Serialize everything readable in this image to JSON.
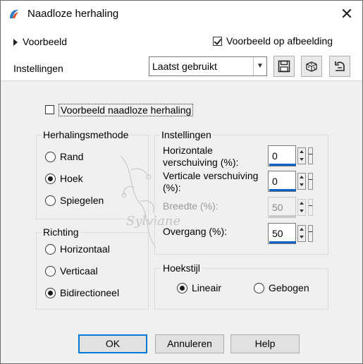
{
  "window": {
    "title": "Naadloze herhaling",
    "close_glyph": "✕"
  },
  "preview": {
    "toggle_label": "Voorbeeld",
    "on_image_label": "Voorbeeld op afbeelding",
    "on_image_checked": true
  },
  "settings_row": {
    "label": "Instellingen",
    "selected": "Laatst gebruikt",
    "icons": [
      "save-preset-icon",
      "randomize-dice-icon",
      "reset-icon"
    ]
  },
  "seamless_preview": {
    "label": "Voorbeeld naadloze herhaling",
    "checked": false
  },
  "method": {
    "title": "Herhalingsmethode",
    "options": [
      "Rand",
      "Hoek",
      "Spiegelen"
    ],
    "selected": "Hoek"
  },
  "direction": {
    "title": "Richting",
    "options": [
      "Horizontaal",
      "Verticaal",
      "Bidirectioneel"
    ],
    "selected": "Bidirectioneel"
  },
  "settings": {
    "title": "Instellingen",
    "h_offset_label_1": "Horizontale",
    "h_offset_label_2": "verschuiving (%):",
    "h_offset": "0",
    "v_offset_label_1": "Verticale verschuiving",
    "v_offset_label_2": "(%):",
    "v_offset": "0",
    "width_label": "Breedte (%):",
    "width": "50",
    "transition_label": "Overgang (%):",
    "transition": "50"
  },
  "corner_style": {
    "title": "Hoekstijl",
    "options": [
      "Lineair",
      "Gebogen"
    ],
    "selected": "Lineair"
  },
  "buttons": {
    "ok": "OK",
    "cancel": "Annuleren",
    "help": "Help"
  },
  "watermark_text": "Sylviane"
}
